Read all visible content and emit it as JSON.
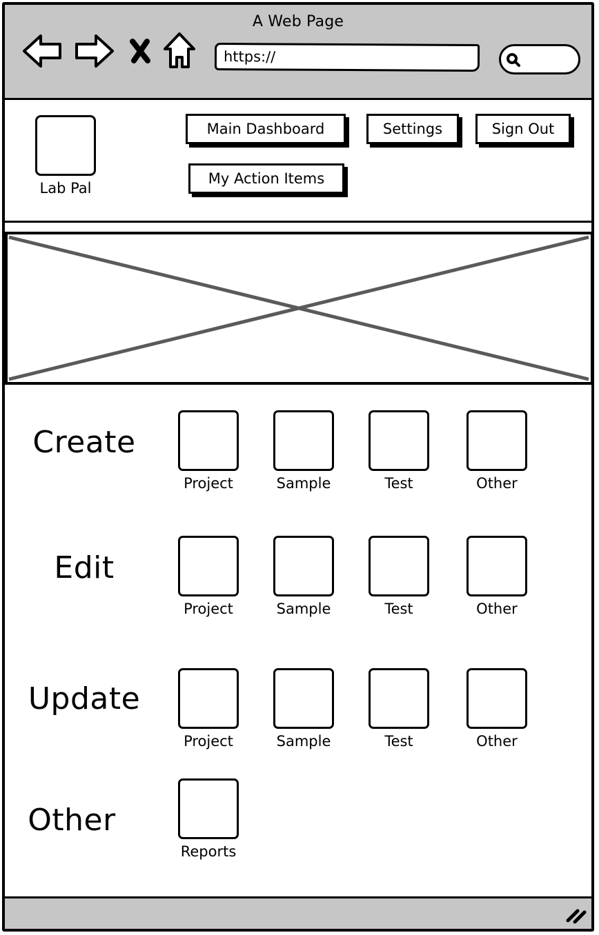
{
  "browser": {
    "title": "A Web Page",
    "url": "https://",
    "icons": [
      "back-arrow-icon",
      "forward-arrow-icon",
      "close-icon",
      "home-icon",
      "search-icon",
      "resize-grip-icon"
    ]
  },
  "header": {
    "logo_label": "Lab Pal",
    "nav": {
      "main_dashboard": "Main Dashboard",
      "settings": "Settings",
      "sign_out": "Sign Out",
      "my_action_items": "My Action Items"
    }
  },
  "sections": {
    "create": {
      "label": "Create",
      "items": [
        "Project",
        "Sample",
        "Test",
        "Other"
      ]
    },
    "edit": {
      "label": "Edit",
      "items": [
        "Project",
        "Sample",
        "Test",
        "Other"
      ]
    },
    "update": {
      "label": "Update",
      "items": [
        "Project",
        "Sample",
        "Test",
        "Other"
      ]
    },
    "other": {
      "label": "Other",
      "items": [
        "Reports"
      ]
    }
  },
  "colors": {
    "chrome": "#c6c6c6",
    "stroke": "#000000",
    "placeholder_cross": "#5a5a5a"
  }
}
